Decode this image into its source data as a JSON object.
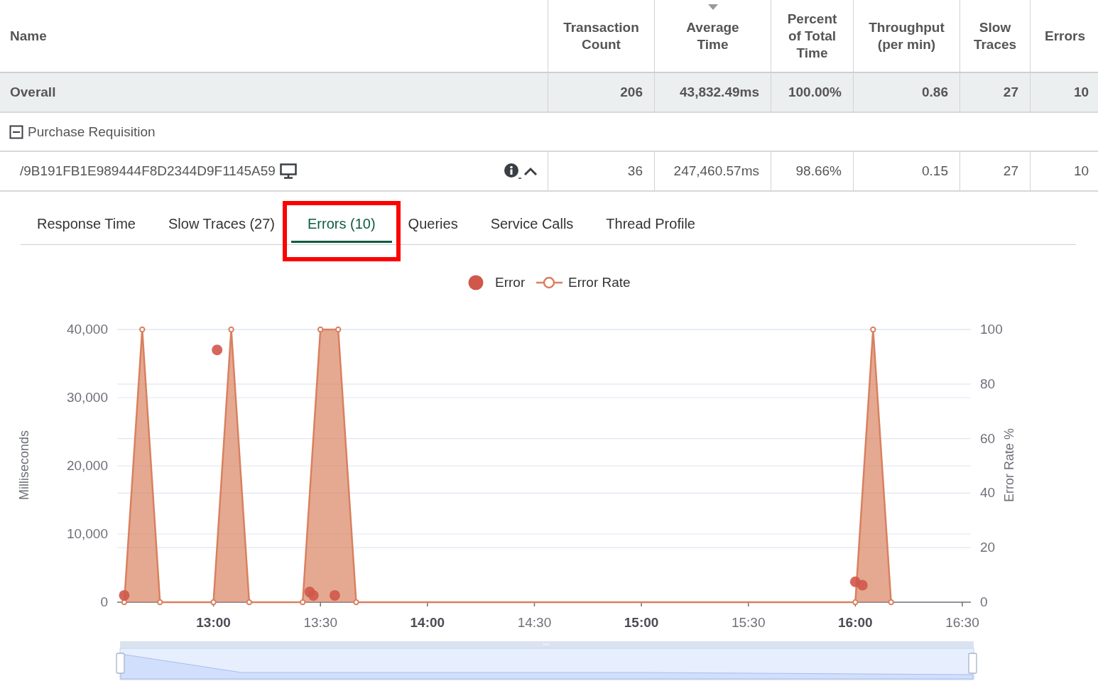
{
  "table": {
    "columns": [
      {
        "label": "Name",
        "sorted": false
      },
      {
        "label": "Transaction Count",
        "sorted": false
      },
      {
        "label": "Average Time",
        "sorted": true
      },
      {
        "label": "Percent of Total Time",
        "sorted": false
      },
      {
        "label": "Throughput (per min)",
        "sorted": false
      },
      {
        "label": "Slow Traces",
        "sorted": false
      },
      {
        "label": "Errors",
        "sorted": false
      }
    ],
    "overall": {
      "name": "Overall",
      "cells": [
        "206",
        "43,832.49ms",
        "100.00%",
        "0.86",
        "27",
        "10"
      ]
    },
    "groups": [
      {
        "name": "Purchase Requisition",
        "expanded": true,
        "rows": [
          {
            "name": "/9B191FB1E989444F8D2344D9F1145A59",
            "cells": [
              "36",
              "247,460.57ms",
              "98.66%",
              "0.15",
              "27",
              "10"
            ]
          }
        ]
      }
    ]
  },
  "tabs": [
    {
      "label": "Response Time",
      "selected": false,
      "highlighted": false
    },
    {
      "label": "Slow Traces (27)",
      "selected": false,
      "highlighted": false
    },
    {
      "label": "Errors (10)",
      "selected": true,
      "highlighted": true
    },
    {
      "label": "Queries",
      "selected": false,
      "highlighted": false
    },
    {
      "label": "Service Calls",
      "selected": false,
      "highlighted": false
    },
    {
      "label": "Thread Profile",
      "selected": false,
      "highlighted": false
    }
  ],
  "chart": {
    "chart_data": {
      "type": "line",
      "ylabel": "Milliseconds",
      "y2label": "Error Rate %",
      "grid": true,
      "legend": "top",
      "x": [
        12.583,
        12.667,
        12.75,
        13,
        13.017,
        13.083,
        13.167,
        13.417,
        13.45,
        13.467,
        13.5,
        13.567,
        13.583,
        13.667,
        16,
        16.033,
        16.083,
        16.167
      ],
      "xlim": [
        12.55,
        16.54
      ],
      "xticks": [
        {
          "value": 13,
          "label": "13:00"
        },
        {
          "value": 13.5,
          "label": "13:30"
        },
        {
          "value": 14,
          "label": "14:00"
        },
        {
          "value": 14.5,
          "label": "14:30"
        },
        {
          "value": 15,
          "label": "15:00"
        },
        {
          "value": 15.5,
          "label": "15:30"
        },
        {
          "value": 16,
          "label": "16:00"
        },
        {
          "value": 16.5,
          "label": "16:30"
        }
      ],
      "ylim": [
        0,
        40000
      ],
      "yticks": [
        {
          "value": 0,
          "label": "0"
        },
        {
          "value": 10000,
          "label": "10,000"
        },
        {
          "value": 20000,
          "label": "20,000"
        },
        {
          "value": 30000,
          "label": "30,000"
        },
        {
          "value": 40000,
          "label": "40,000"
        }
      ],
      "y2lim": [
        0,
        100
      ],
      "y2ticks": [
        0,
        20,
        40,
        60,
        80,
        100
      ],
      "series": [
        {
          "name": "Error",
          "type": "scatter",
          "color": "#d0584a",
          "values": [
            1000,
            null,
            null,
            null,
            37000,
            null,
            null,
            null,
            1500,
            1000,
            null,
            1000,
            null,
            null,
            3000,
            2500,
            null,
            null
          ]
        },
        {
          "name": "Error Rate",
          "type": "area",
          "axis": "y2",
          "color": "#d9805f",
          "values": [
            0,
            100,
            0,
            0,
            null,
            100,
            0,
            0,
            null,
            null,
            100,
            null,
            100,
            0,
            0,
            null,
            100,
            0
          ]
        }
      ]
    }
  }
}
